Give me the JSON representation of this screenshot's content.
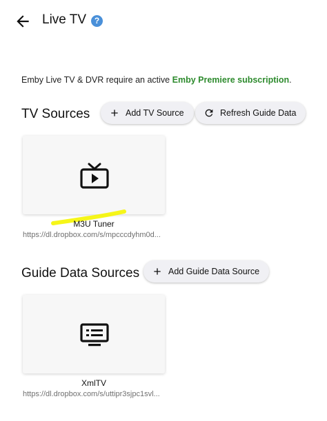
{
  "header": {
    "title": "Live TV",
    "help": "?"
  },
  "premium_note": {
    "text": "Emby Live TV & DVR require an active ",
    "link": "Emby Premiere subscription",
    "end": "."
  },
  "tv_sources": {
    "title": "TV Sources",
    "add_label": "Add TV Source",
    "refresh_label": "Refresh Guide Data",
    "cards": [
      {
        "name": "M3U Tuner",
        "url": "https://dl.dropbox.com/s/mpcccdyhm0d..."
      }
    ]
  },
  "guide_sources": {
    "title": "Guide Data Sources",
    "add_label": "Add Guide Data Source",
    "cards": [
      {
        "name": "XmlTV",
        "url": "https://dl.dropbox.com/s/uttipr3sjpc1svl..."
      }
    ]
  },
  "colors": {
    "link": "#2e8b2e",
    "help": "#4a90d9",
    "highlight": "#f5f500"
  }
}
